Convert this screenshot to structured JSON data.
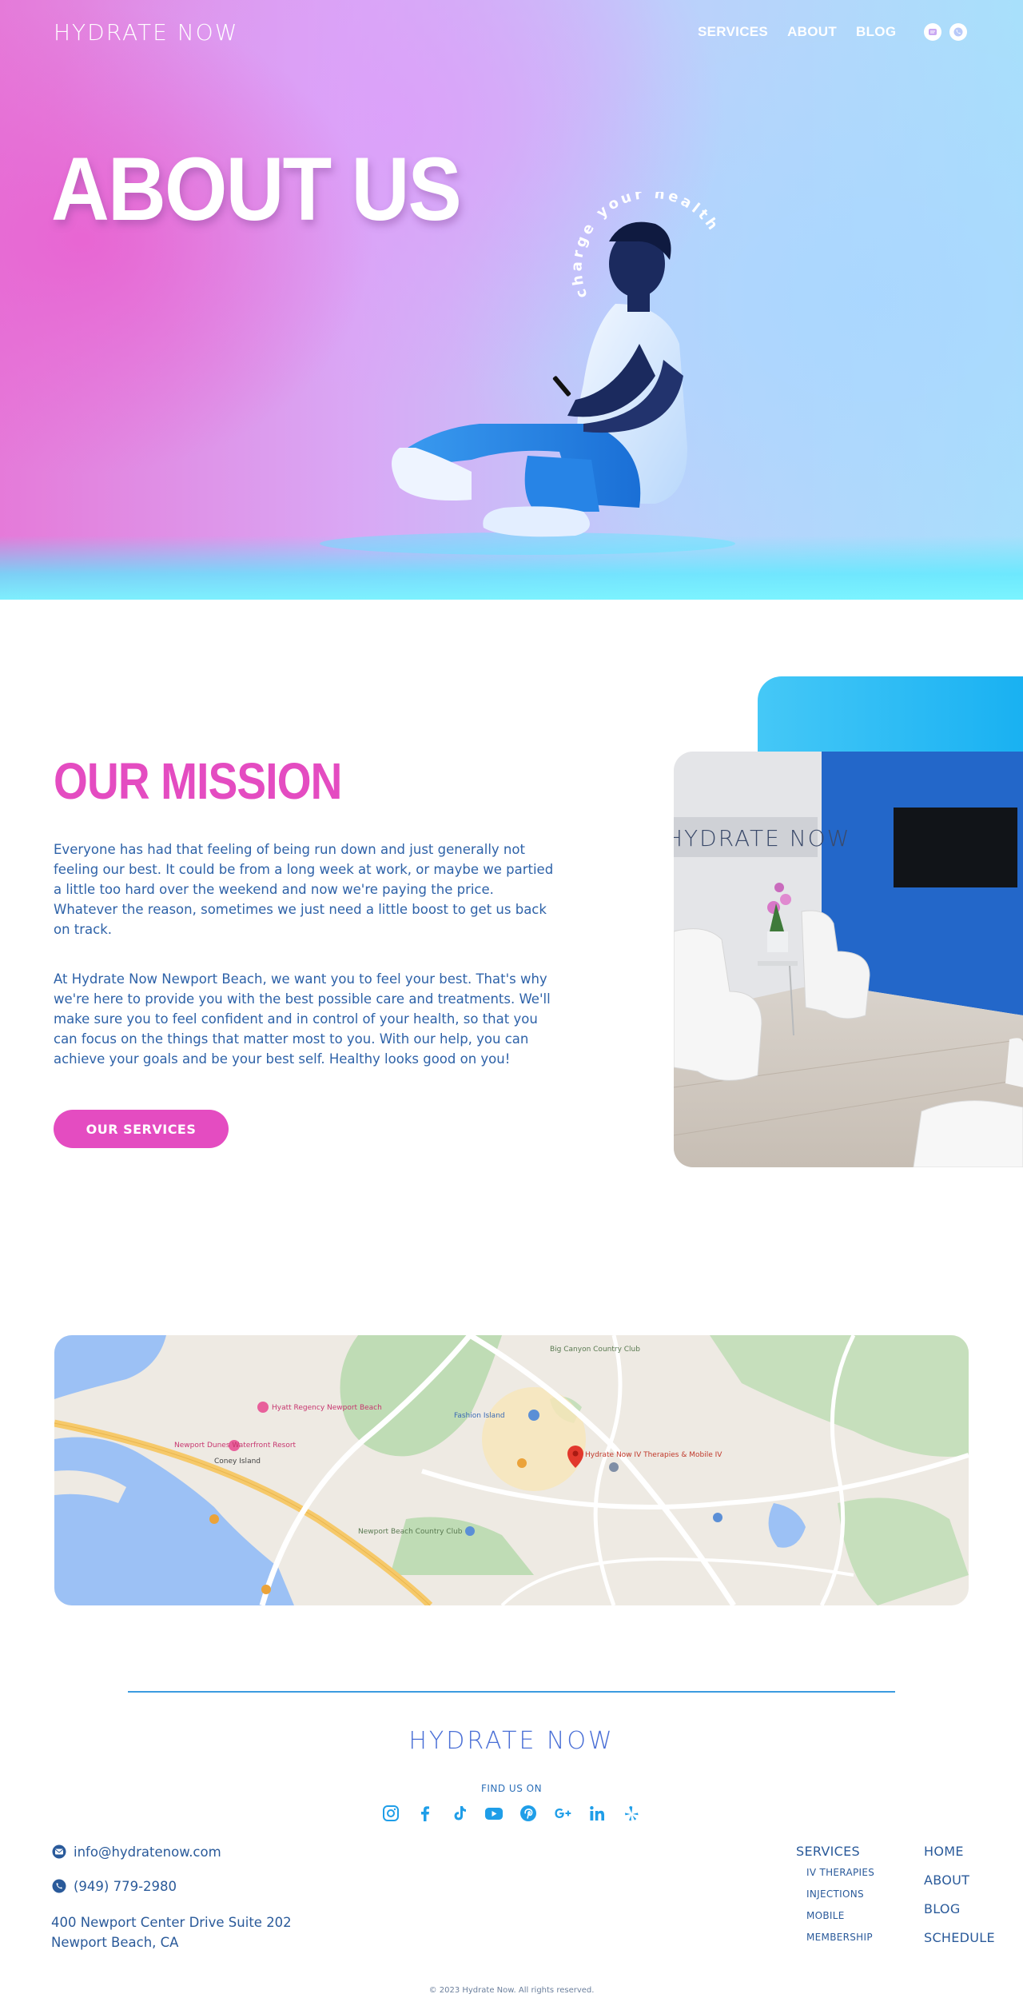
{
  "header": {
    "brand": "HYDRATE NOW",
    "nav": [
      "SERVICES",
      "ABOUT",
      "BLOG"
    ],
    "icons": [
      "sms-icon",
      "whatsapp-icon"
    ]
  },
  "hero": {
    "title": "ABOUT US",
    "arc_text": "charge your health"
  },
  "mission": {
    "title": "OUR MISSION",
    "paragraph1": "Everyone has had that feeling of being run down and just generally not feeling our best. It could be from a long week at work, or maybe we partied a little too hard over the weekend and now we're paying the price. Whatever the reason, sometimes we just need a little boost to get us back on track.",
    "paragraph2": "At Hydrate Now Newport Beach, we want you to feel your best. That's why we're here to provide you with the best possible care and treatments. We'll make sure you to feel confident and in control of your health, so that you can focus on the things that matter most to you. With our help, you can achieve your goals and be your best self. Healthy looks good on you!",
    "button": "OUR SERVICES",
    "room_sign": "HYDRATE NOW"
  },
  "map": {
    "places": [
      "Newport Dunes Waterfront Resort",
      "Hyatt Regency Newport Beach",
      "Fashion Island",
      "Hydrate Now IV Therapies & Mobile IV",
      "Newport Beach Country Club",
      "Big Canyon Country Club",
      "Coney Island"
    ]
  },
  "footer": {
    "brand": "HYDRATE NOW",
    "find_us": "FIND US ON",
    "social_icons": [
      "instagram-icon",
      "facebook-icon",
      "tiktok-icon",
      "youtube-icon",
      "pinterest-icon",
      "google-plus-icon",
      "linkedin-icon",
      "yelp-icon"
    ],
    "email": "info@hydratenow.com",
    "phone": "(949) 779-2980",
    "address_line1": "400 Newport Center Drive Suite 202",
    "address_line2": "Newport Beach, CA",
    "services_heading": "SERVICES",
    "services": [
      "IV THERAPIES",
      "INJECTIONS",
      "MOBILE",
      "MEMBERSHIP"
    ],
    "nav": [
      "HOME",
      "ABOUT",
      "BLOG",
      "SCHEDULE"
    ],
    "copyright": "© 2023 Hydrate Now. All rights reserved."
  },
  "colors": {
    "accent_pink": "#e44cc1",
    "accent_blue": "#19b1f2",
    "text_blue": "#2a5a9a"
  }
}
